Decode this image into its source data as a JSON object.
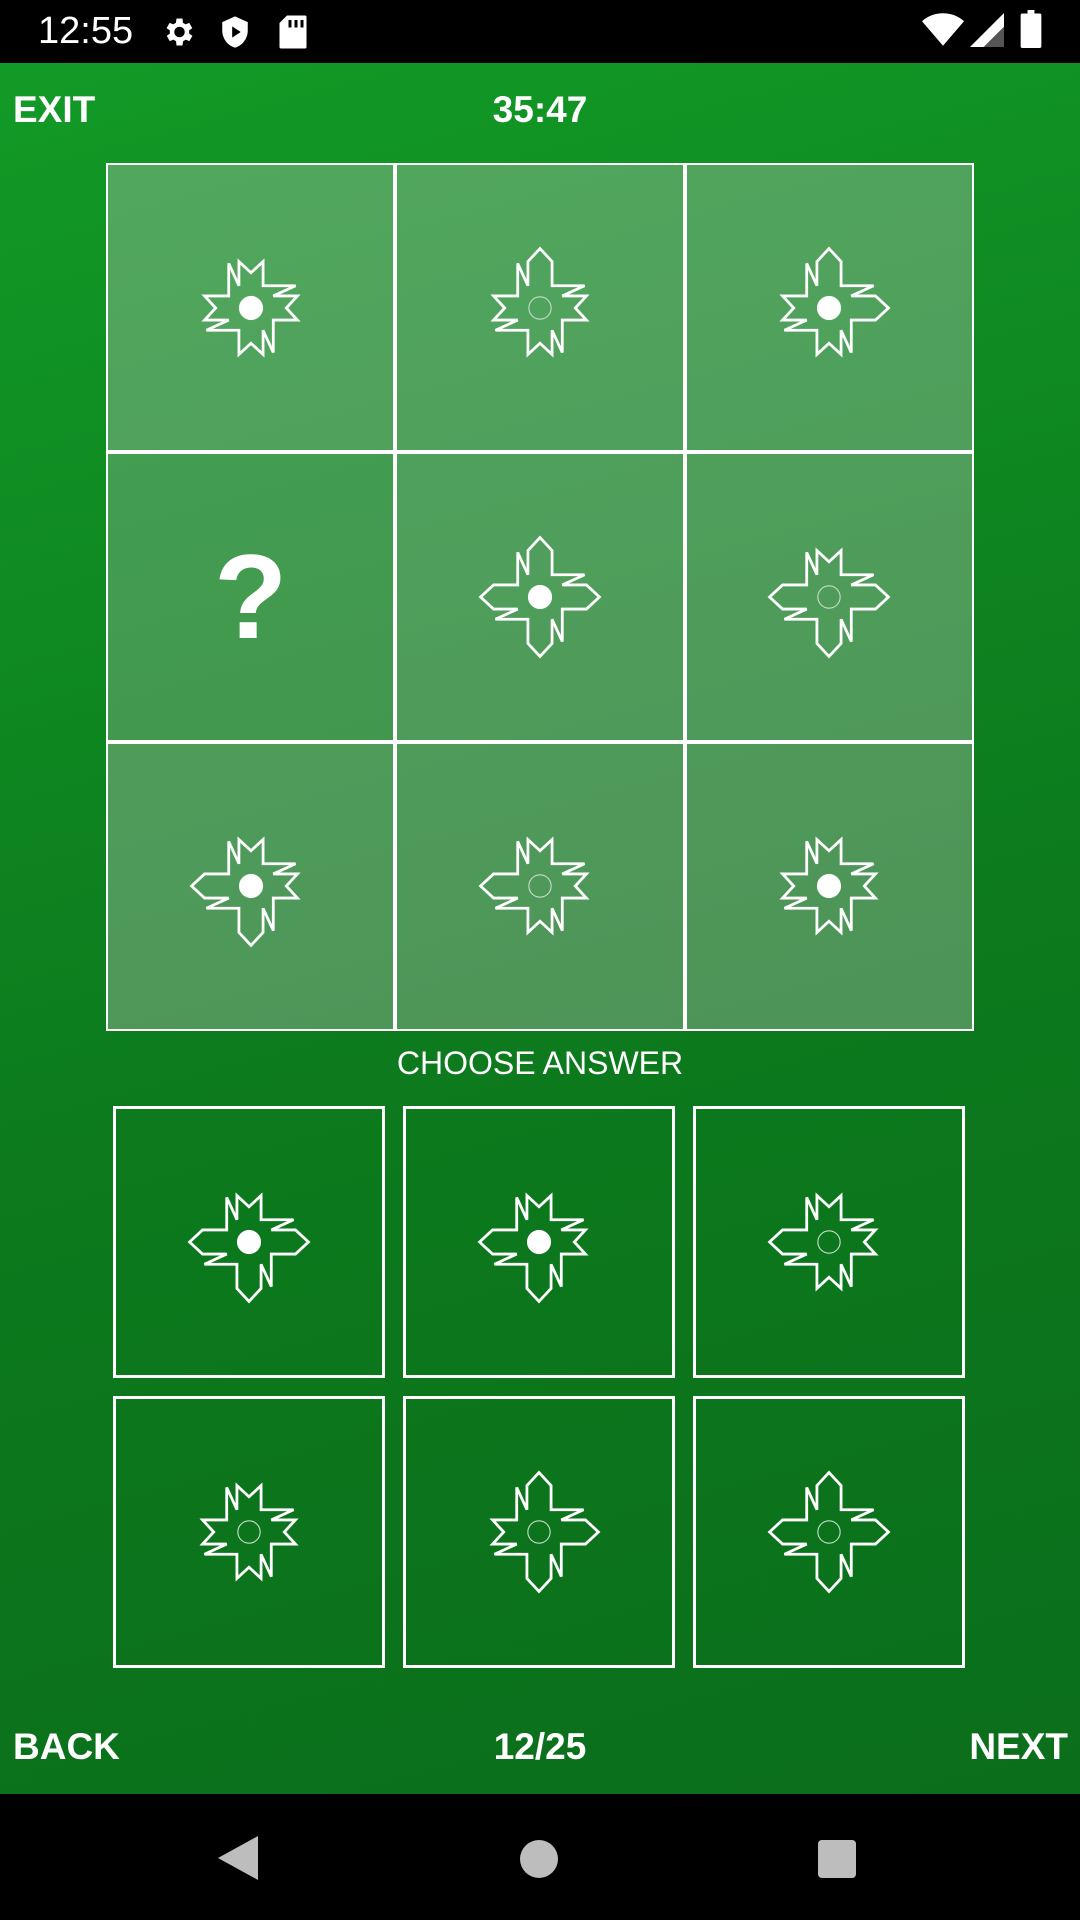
{
  "status_bar": {
    "time": "12:55",
    "left_icons": [
      "gear-icon",
      "shield-icon",
      "sd-card-icon"
    ],
    "right_icons": [
      "wifi-icon",
      "signal-icon",
      "battery-icon"
    ]
  },
  "header": {
    "exit_label": "EXIT",
    "timer": "35:47"
  },
  "matrix": {
    "cells": [
      {
        "figure": "star-8-point",
        "dot": "filled"
      },
      {
        "figure": "star-with-top-arm",
        "dot": "hollow"
      },
      {
        "figure": "star-with-top-right-arms",
        "dot": "filled"
      },
      {
        "figure": "missing",
        "label": "?"
      },
      {
        "figure": "four-arm-cross",
        "dot": "filled"
      },
      {
        "figure": "star-with-left-right-bottom-arms",
        "dot": "hollow"
      },
      {
        "figure": "star-with-left-bottom-arms",
        "dot": "filled"
      },
      {
        "figure": "star-with-left-arm",
        "dot": "hollow"
      },
      {
        "figure": "star-8-point",
        "dot": "filled"
      }
    ]
  },
  "choose_label": "CHOOSE ANSWER",
  "answers": [
    {
      "figure": "star-with-left-right-bottom-arms",
      "dot": "filled"
    },
    {
      "figure": "star-with-left-bottom-arms",
      "dot": "filled"
    },
    {
      "figure": "star-with-left-arm",
      "dot": "hollow"
    },
    {
      "figure": "star-8-point",
      "dot": "hollow"
    },
    {
      "figure": "star-with-top-right-bottom-arms",
      "dot": "hollow"
    },
    {
      "figure": "four-arm-cross",
      "dot": "hollow"
    }
  ],
  "footer": {
    "back_label": "BACK",
    "progress": "12/25",
    "next_label": "NEXT"
  },
  "nav_bar": {
    "buttons": [
      "back-triangle-icon",
      "home-circle-icon",
      "recents-square-icon"
    ]
  },
  "colors": {
    "background_top": "#129a26",
    "background_bottom": "#0b6e1b",
    "cell_fill": "#4f8c60",
    "stroke": "#ffffff"
  }
}
